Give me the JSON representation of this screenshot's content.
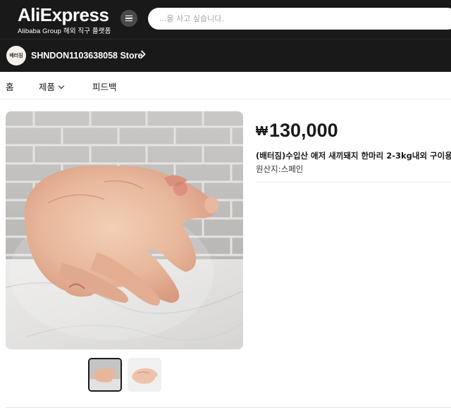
{
  "header": {
    "logo_main": "AliExpress",
    "logo_sub_en": "Alibaba Group",
    "logo_sub_kr": "해외 직구 플랫폼",
    "search_placeholder": "...을 사고 싶습니다."
  },
  "store": {
    "logo_text": "배터짐",
    "name": "SHNDON1103638058 Store",
    "chevron": "›"
  },
  "nav": {
    "home": "홈",
    "products": "제품",
    "feedback": "피드백"
  },
  "product": {
    "currency_symbol": "₩",
    "price": "130,000",
    "title": "(배터짐)수입산 애저 새끼돼지 한마리 2-3kg내외 구이용",
    "origin": "원산지:스페인"
  },
  "gallery": {
    "main_alt": "whole suckling pig in plastic packaging",
    "thumbnails": 2,
    "selected_thumbnail": 1
  },
  "colors": {
    "header_bg": "#191919",
    "text": "#191919"
  }
}
